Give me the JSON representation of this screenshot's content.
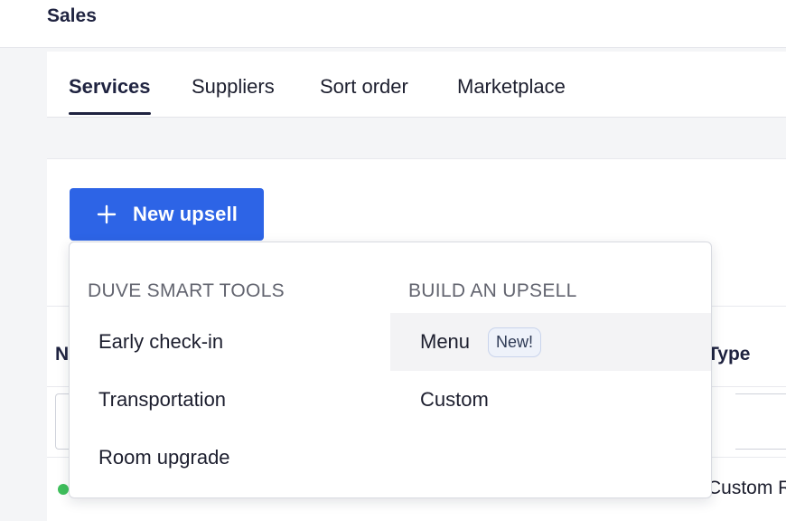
{
  "header": {
    "title": "Sales"
  },
  "tabs": [
    {
      "label": "Services",
      "active": true
    },
    {
      "label": "Suppliers",
      "active": false
    },
    {
      "label": "Sort order",
      "active": false
    },
    {
      "label": "Marketplace",
      "active": false
    }
  ],
  "toolbar": {
    "new_upsell_label": "New upsell",
    "new_upsell_icon": "plus-icon"
  },
  "table": {
    "columns": {
      "name_partial": "N",
      "type_partial": "Type"
    },
    "rows": [
      {
        "type_partial": "Custom R",
        "status_color": "#3fc05c"
      }
    ]
  },
  "dropdown": {
    "smart_tools": {
      "heading": "DUVE SMART TOOLS",
      "items": [
        "Early check-in",
        "Transportation",
        "Room upgrade"
      ]
    },
    "build": {
      "heading": "BUILD AN UPSELL",
      "items": [
        {
          "label": "Menu",
          "badge": "New!"
        },
        {
          "label": "Custom"
        }
      ]
    }
  },
  "colors": {
    "primary": "#2d64e6",
    "navy": "#1f2340",
    "status_active": "#3fc05c"
  }
}
